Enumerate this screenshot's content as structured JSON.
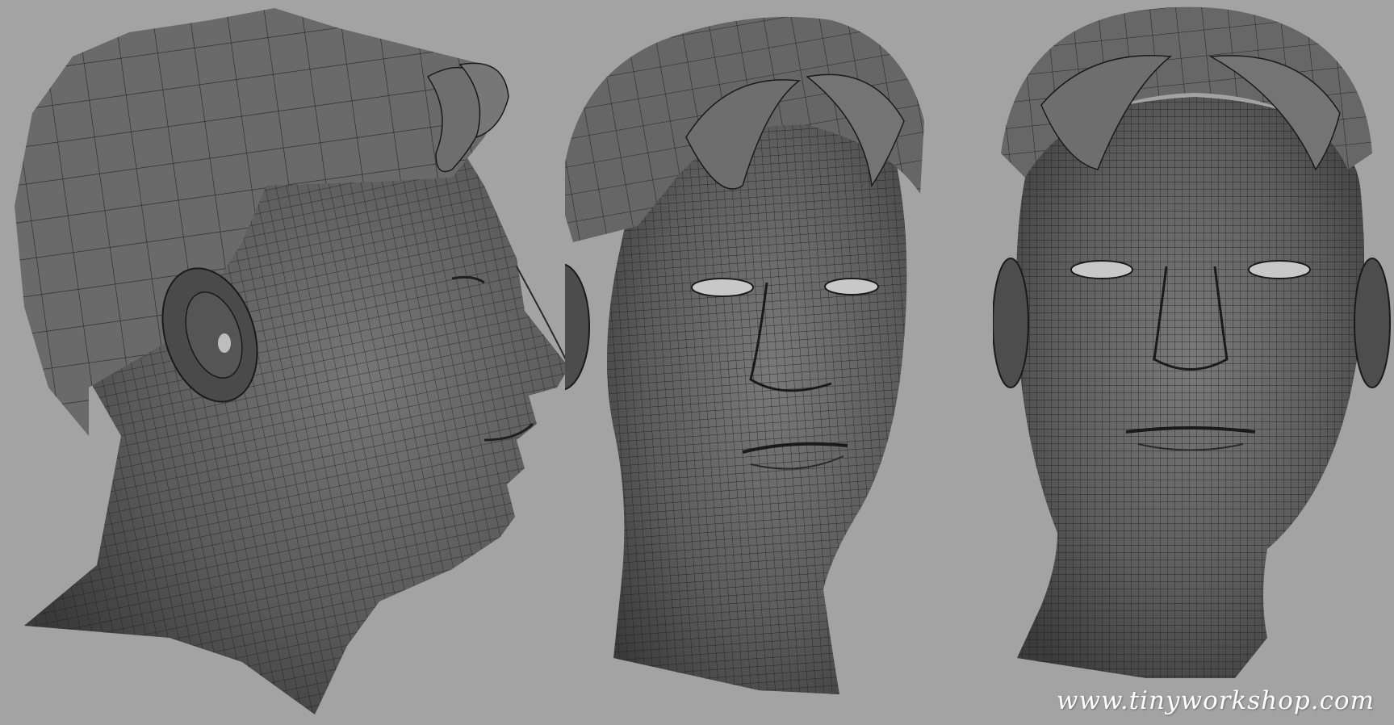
{
  "watermark": {
    "text": "www.tinyworkshop.com",
    "color": "#ffffff"
  },
  "colors": {
    "background": "#a3a3a3",
    "mesh_fill": "#5f5f5f",
    "mesh_dark": "#2e2e2e",
    "mesh_light": "#7c7c7c",
    "wire": "#1a1a1a"
  },
  "views": [
    {
      "name": "side-profile",
      "icon": "wireframe-head-profile-icon"
    },
    {
      "name": "three-quarter",
      "icon": "wireframe-head-three-quarter-icon"
    },
    {
      "name": "front",
      "icon": "wireframe-head-front-icon"
    }
  ]
}
